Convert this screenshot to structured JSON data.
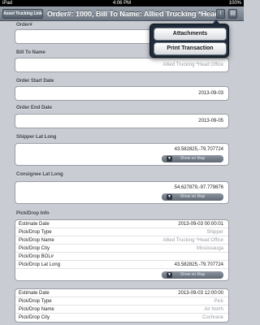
{
  "status_bar": {
    "carrier": "iPad",
    "time": "4:06 PM",
    "battery": "100%"
  },
  "nav": {
    "back_label": "Asset Trucking Link",
    "title": "Order#: 1000, Bill To Name: Allied Trucking *Head...",
    "icon_a": "info-icon",
    "icon_b": "menu-icon"
  },
  "popover": {
    "attachments_label": "Attachments",
    "print_label": "Print Transaction"
  },
  "form": {
    "order_label": "Order#",
    "order_value": "",
    "bill_to_label": "Bill To Name",
    "bill_to_value": "Allied Trucking *Head Office",
    "order_start_label": "Order Start Date",
    "order_start_value": "2013-09-03",
    "order_end_label": "Order End Date",
    "order_end_value": "2013-09-05",
    "shipper_label": "Shipper Lat Long",
    "shipper_value": "43.582825,-79.707724",
    "consignee_label": "Consignee Lat Long",
    "consignee_value": "54.627879,-97.779876",
    "show_on_map": "Show on Map"
  },
  "pick_drop": {
    "section_label": "Pick/Drop Info",
    "entries": [
      {
        "estimate_date_k": "Estimate Date",
        "estimate_date_v": "2013-09-03 00:00:01",
        "type_k": "Pick/Drop Type",
        "type_v": "Shipper",
        "name_k": "Pick/Drop Name",
        "name_v": "Allied Trucking *Head Office",
        "city_k": "Pick/Drop City",
        "city_v": "Mississauga",
        "bol_k": "Pick/Drop BOL#",
        "bol_v": "",
        "latlong_k": "Pick/Drop Lat Long",
        "latlong_v": "43.582825,-79.707724"
      },
      {
        "estimate_date_k": "Estimate Date",
        "estimate_date_v": "2013-09-03 12:00:00",
        "type_k": "Pick/Drop Type",
        "type_v": "Pick",
        "name_k": "Pick/Drop Name",
        "name_v": "Air North",
        "city_k": "Pick/Drop City",
        "city_v": "Cochrane"
      }
    ]
  }
}
